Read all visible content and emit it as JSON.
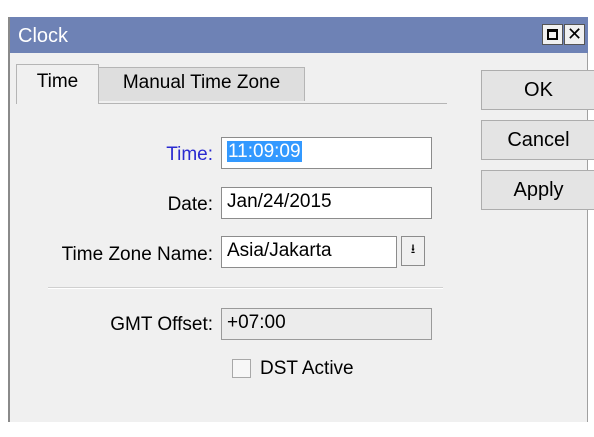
{
  "window": {
    "title": "Clock",
    "maximize_icon": "maximize-icon",
    "close_icon": "close-icon"
  },
  "tabs": [
    {
      "label": "Time",
      "active": true
    },
    {
      "label": "Manual Time Zone",
      "active": false
    }
  ],
  "form": {
    "time_label": "Time:",
    "time_value": "11:09:09",
    "date_label": "Date:",
    "date_value": "Jan/24/2015",
    "tz_label": "Time Zone Name:",
    "tz_value": "Asia/Jakarta",
    "tz_dropdown_icon": "dropdown-arrow-icon",
    "gmt_label": "GMT Offset:",
    "gmt_value": "+07:00",
    "dst_label": "DST Active",
    "dst_checked": false
  },
  "buttons": {
    "ok": "OK",
    "cancel": "Cancel",
    "apply": "Apply"
  },
  "colors": {
    "titlebar": "#6e82b5",
    "focused_label": "#2a2ad0",
    "selection": "#3399ff"
  }
}
